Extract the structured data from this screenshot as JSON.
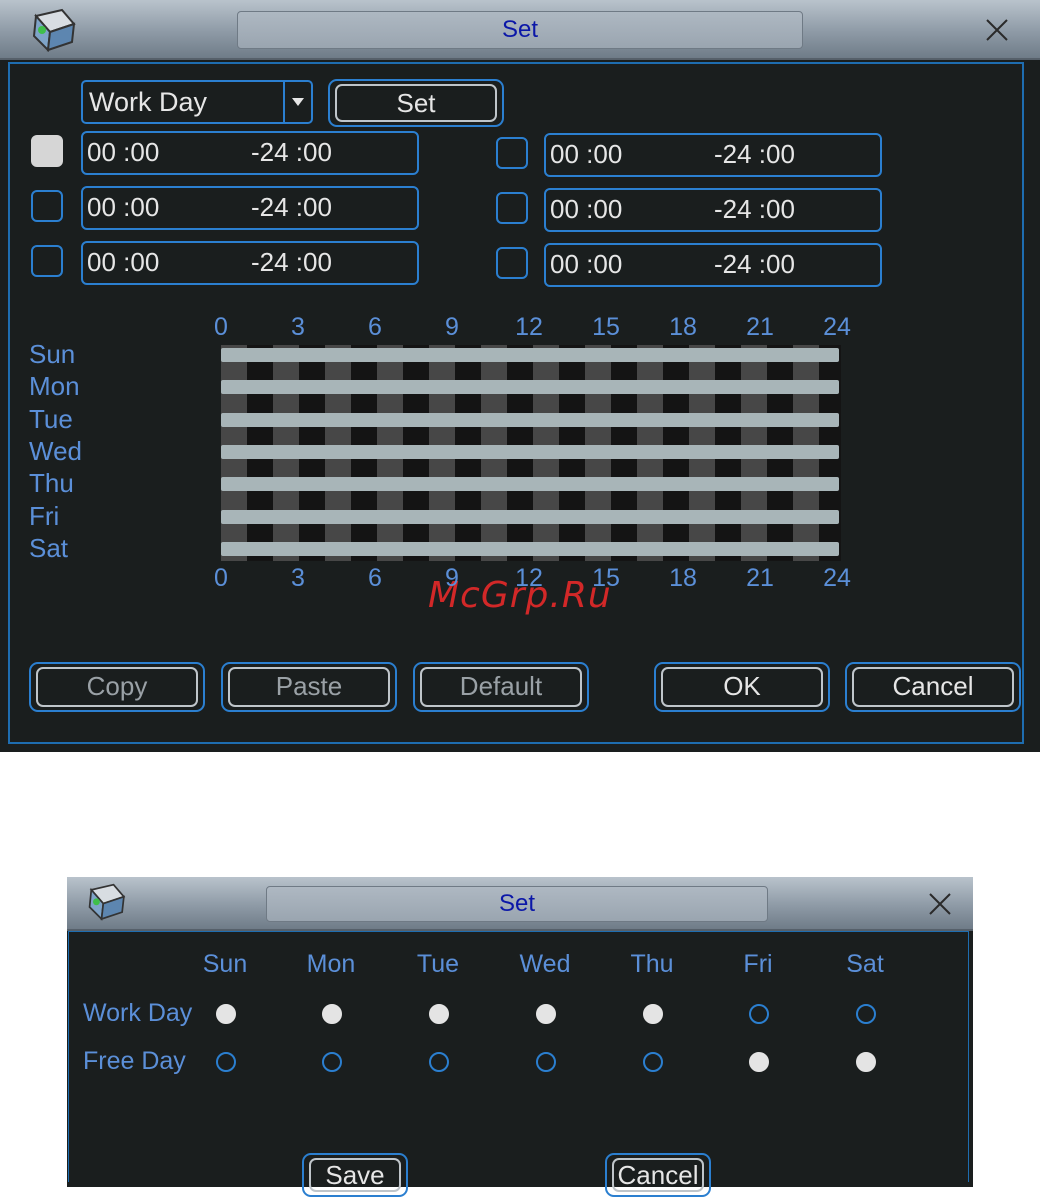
{
  "dialog1": {
    "title": "Set",
    "period_select": "Work Day",
    "set_button": "Set",
    "periods": [
      {
        "checked": true,
        "start": "00 :00",
        "end": "-24 :00"
      },
      {
        "checked": false,
        "start": "00 :00",
        "end": "-24 :00"
      },
      {
        "checked": false,
        "start": "00 :00",
        "end": "-24 :00"
      },
      {
        "checked": false,
        "start": "00 :00",
        "end": "-24 :00"
      },
      {
        "checked": false,
        "start": "00 :00",
        "end": "-24 :00"
      },
      {
        "checked": false,
        "start": "00 :00",
        "end": "-24 :00"
      }
    ],
    "hours": [
      "0",
      "3",
      "6",
      "9",
      "12",
      "15",
      "18",
      "21",
      "24"
    ],
    "days": [
      "Sun",
      "Mon",
      "Tue",
      "Wed",
      "Thu",
      "Fri",
      "Sat"
    ],
    "buttons": {
      "copy": "Copy",
      "paste": "Paste",
      "default": "Default",
      "ok": "OK",
      "cancel": "Cancel"
    },
    "watermark": "McGrp.Ru"
  },
  "dialog2": {
    "title": "Set",
    "days": [
      "Sun",
      "Mon",
      "Tue",
      "Wed",
      "Thu",
      "Fri",
      "Sat"
    ],
    "rows": [
      {
        "label": "Work Day",
        "selected": [
          true,
          true,
          true,
          true,
          true,
          false,
          false
        ]
      },
      {
        "label": "Free Day",
        "selected": [
          false,
          false,
          false,
          false,
          false,
          true,
          true
        ]
      }
    ],
    "buttons": {
      "save": "Save",
      "cancel": "Cancel"
    }
  }
}
